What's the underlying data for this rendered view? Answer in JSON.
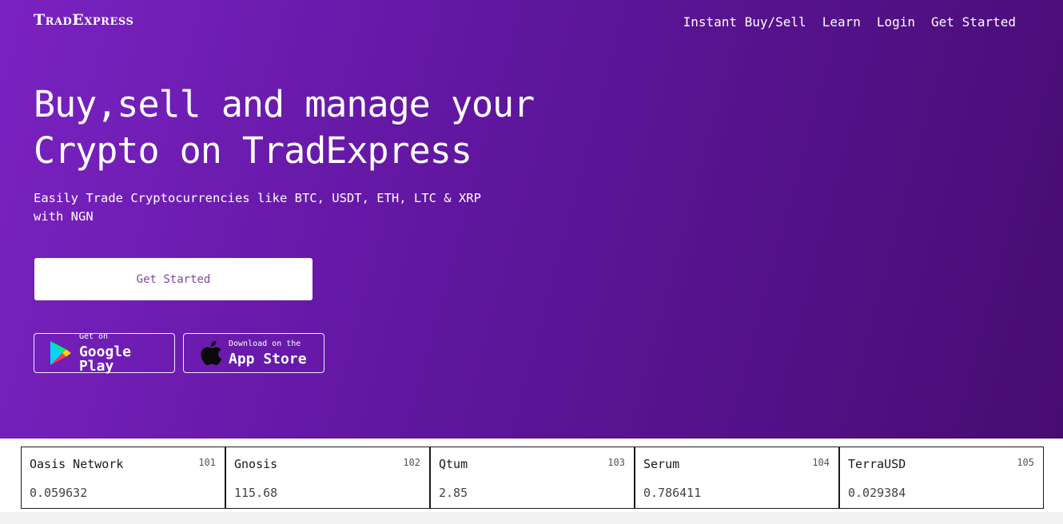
{
  "brand": {
    "logo_text": "TradExpress"
  },
  "nav": [
    {
      "label": "Instant Buy/Sell"
    },
    {
      "label": "Learn"
    },
    {
      "label": "Login"
    },
    {
      "label": "Get Started"
    }
  ],
  "hero": {
    "headline": "Buy,sell and manage your Crypto on TradExpress",
    "subheadline": "Easily Trade Cryptocurrencies like BTC, USDT, ETH, LTC & XRP with NGN",
    "cta_label": "Get Started"
  },
  "stores": {
    "google_play": {
      "small": "Get on",
      "big": "Google Play",
      "icon": "google-play-icon"
    },
    "app_store": {
      "small": "Download on the",
      "big": "App Store",
      "icon": "apple-icon"
    }
  },
  "ticker": [
    {
      "name": "Oasis Network",
      "rank": "101",
      "price": "0.059632"
    },
    {
      "name": "Gnosis",
      "rank": "102",
      "price": "115.68"
    },
    {
      "name": "Qtum",
      "rank": "103",
      "price": "2.85"
    },
    {
      "name": "Serum",
      "rank": "104",
      "price": "0.786411"
    },
    {
      "name": "TerraUSD",
      "rank": "105",
      "price": "0.029384"
    }
  ],
  "colors": {
    "hero_gradient_start": "#7a22c2",
    "hero_gradient_end": "#470c72",
    "cta_text": "#7b4aa0"
  }
}
